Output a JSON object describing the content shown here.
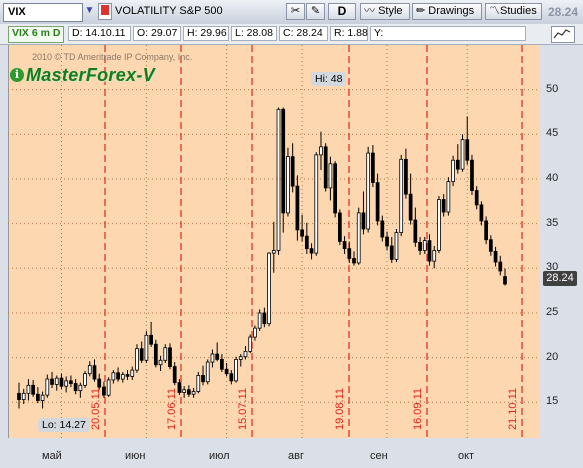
{
  "toolbar": {
    "symbol": "VIX",
    "description": "VOLATILITY S&P 500",
    "aggregation": "D",
    "style_label": "Style",
    "drawings_label": "Drawings",
    "studies_label": "Studies",
    "last_price": "28.24"
  },
  "info_bar": {
    "period": "VIX 6 m D",
    "date": "D: 14.10.11",
    "open": "O: 29.07",
    "high": "H: 29.96",
    "low": "L: 28.08",
    "close": "C: 28.24",
    "range": "R: 1.88",
    "y": "Y:"
  },
  "watermark": {
    "copyright": "2010 © TD Ameritrade IP Company, Inc.",
    "brand": "MasterForex-V"
  },
  "chart_data": {
    "type": "candlestick",
    "symbol": "VIX",
    "ylim": [
      11,
      55
    ],
    "y_ticks": [
      15,
      20,
      25,
      30,
      35,
      40,
      45,
      50
    ],
    "x_month_labels": [
      "май",
      "июн",
      "июл",
      "авг",
      "сен",
      "окт"
    ],
    "vertical_date_markers": [
      "20.05.11",
      "17.06.11",
      "15.07.11",
      "19.08.11",
      "16.09.11",
      "21.10.11"
    ],
    "hi_label": "Hi: 48",
    "lo_label": "Lo: 14.27",
    "last_price_tag": "28.24",
    "candles": [
      {
        "o": 16.0,
        "h": 17.2,
        "l": 14.3,
        "c": 15.3
      },
      {
        "o": 15.3,
        "h": 16.5,
        "l": 14.8,
        "c": 16.0
      },
      {
        "o": 16.0,
        "h": 17.6,
        "l": 15.2,
        "c": 16.9
      },
      {
        "o": 16.9,
        "h": 17.5,
        "l": 15.6,
        "c": 15.9
      },
      {
        "o": 15.9,
        "h": 16.7,
        "l": 14.9,
        "c": 15.2
      },
      {
        "o": 15.2,
        "h": 16.2,
        "l": 14.3,
        "c": 15.8
      },
      {
        "o": 15.8,
        "h": 18.1,
        "l": 15.5,
        "c": 17.6
      },
      {
        "o": 17.6,
        "h": 18.4,
        "l": 16.6,
        "c": 17.0
      },
      {
        "o": 17.0,
        "h": 18.0,
        "l": 16.3,
        "c": 17.7
      },
      {
        "o": 17.7,
        "h": 18.2,
        "l": 16.5,
        "c": 16.8
      },
      {
        "o": 16.8,
        "h": 17.9,
        "l": 16.1,
        "c": 17.4
      },
      {
        "o": 17.4,
        "h": 18.0,
        "l": 16.7,
        "c": 17.1
      },
      {
        "o": 17.1,
        "h": 17.6,
        "l": 15.9,
        "c": 16.3
      },
      {
        "o": 16.3,
        "h": 17.2,
        "l": 15.5,
        "c": 16.9
      },
      {
        "o": 16.9,
        "h": 18.5,
        "l": 16.6,
        "c": 18.2
      },
      {
        "o": 18.2,
        "h": 19.6,
        "l": 17.9,
        "c": 19.1
      },
      {
        "o": 19.1,
        "h": 19.8,
        "l": 17.3,
        "c": 17.6
      },
      {
        "o": 17.6,
        "h": 18.2,
        "l": 16.4,
        "c": 16.7
      },
      {
        "o": 16.7,
        "h": 17.3,
        "l": 15.5,
        "c": 15.8
      },
      {
        "o": 15.8,
        "h": 17.8,
        "l": 15.6,
        "c": 17.5
      },
      {
        "o": 17.5,
        "h": 18.6,
        "l": 17.1,
        "c": 18.3
      },
      {
        "o": 18.3,
        "h": 18.9,
        "l": 17.3,
        "c": 17.6
      },
      {
        "o": 17.6,
        "h": 18.4,
        "l": 17.2,
        "c": 18.1
      },
      {
        "o": 18.1,
        "h": 18.6,
        "l": 17.5,
        "c": 17.9
      },
      {
        "o": 17.9,
        "h": 19.0,
        "l": 17.5,
        "c": 18.6
      },
      {
        "o": 18.6,
        "h": 21.5,
        "l": 18.3,
        "c": 21.0
      },
      {
        "o": 21.0,
        "h": 21.8,
        "l": 19.4,
        "c": 19.7
      },
      {
        "o": 19.7,
        "h": 23.0,
        "l": 19.4,
        "c": 22.5
      },
      {
        "o": 22.5,
        "h": 24.0,
        "l": 21.2,
        "c": 21.5
      },
      {
        "o": 21.5,
        "h": 22.0,
        "l": 18.9,
        "c": 19.2
      },
      {
        "o": 19.2,
        "h": 20.2,
        "l": 18.5,
        "c": 19.7
      },
      {
        "o": 19.7,
        "h": 21.5,
        "l": 19.4,
        "c": 21.1
      },
      {
        "o": 21.1,
        "h": 21.6,
        "l": 18.7,
        "c": 19.0
      },
      {
        "o": 19.0,
        "h": 19.5,
        "l": 16.9,
        "c": 17.2
      },
      {
        "o": 17.2,
        "h": 17.6,
        "l": 15.8,
        "c": 16.1
      },
      {
        "o": 16.1,
        "h": 16.8,
        "l": 15.5,
        "c": 16.4
      },
      {
        "o": 16.4,
        "h": 16.9,
        "l": 15.6,
        "c": 15.9
      },
      {
        "o": 15.9,
        "h": 16.6,
        "l": 15.5,
        "c": 16.2
      },
      {
        "o": 16.2,
        "h": 18.4,
        "l": 16.0,
        "c": 18.0
      },
      {
        "o": 18.0,
        "h": 19.1,
        "l": 16.9,
        "c": 17.3
      },
      {
        "o": 17.3,
        "h": 19.8,
        "l": 17.0,
        "c": 19.5
      },
      {
        "o": 19.5,
        "h": 20.9,
        "l": 18.9,
        "c": 20.4
      },
      {
        "o": 20.4,
        "h": 21.7,
        "l": 19.6,
        "c": 19.8
      },
      {
        "o": 19.8,
        "h": 20.4,
        "l": 18.4,
        "c": 18.7
      },
      {
        "o": 18.7,
        "h": 19.4,
        "l": 17.9,
        "c": 18.2
      },
      {
        "o": 18.2,
        "h": 18.6,
        "l": 17.0,
        "c": 17.4
      },
      {
        "o": 17.4,
        "h": 20.1,
        "l": 17.2,
        "c": 19.8
      },
      {
        "o": 19.8,
        "h": 20.4,
        "l": 19.0,
        "c": 20.1
      },
      {
        "o": 20.1,
        "h": 21.3,
        "l": 19.8,
        "c": 20.7
      },
      {
        "o": 20.7,
        "h": 22.6,
        "l": 20.5,
        "c": 22.3
      },
      {
        "o": 22.3,
        "h": 23.6,
        "l": 21.9,
        "c": 23.3
      },
      {
        "o": 23.3,
        "h": 25.4,
        "l": 23.0,
        "c": 25.0
      },
      {
        "o": 25.0,
        "h": 25.6,
        "l": 23.4,
        "c": 23.8
      },
      {
        "o": 23.8,
        "h": 31.8,
        "l": 23.5,
        "c": 31.7
      },
      {
        "o": 31.7,
        "h": 35.2,
        "l": 29.5,
        "c": 32.0
      },
      {
        "o": 32.0,
        "h": 48.0,
        "l": 31.5,
        "c": 47.8
      },
      {
        "o": 47.8,
        "h": 48.0,
        "l": 34.0,
        "c": 36.2
      },
      {
        "o": 36.2,
        "h": 43.5,
        "l": 35.8,
        "c": 42.5
      },
      {
        "o": 42.5,
        "h": 44.0,
        "l": 38.5,
        "c": 39.2
      },
      {
        "o": 39.2,
        "h": 40.4,
        "l": 33.1,
        "c": 34.3
      },
      {
        "o": 34.3,
        "h": 36.0,
        "l": 33.0,
        "c": 33.6
      },
      {
        "o": 33.6,
        "h": 35.1,
        "l": 31.6,
        "c": 32.2
      },
      {
        "o": 32.2,
        "h": 32.8,
        "l": 31.0,
        "c": 31.7
      },
      {
        "o": 31.7,
        "h": 43.0,
        "l": 31.4,
        "c": 42.7
      },
      {
        "o": 42.7,
        "h": 45.3,
        "l": 41.0,
        "c": 43.6
      },
      {
        "o": 43.6,
        "h": 44.0,
        "l": 38.6,
        "c": 39.0
      },
      {
        "o": 39.0,
        "h": 42.5,
        "l": 37.6,
        "c": 41.7
      },
      {
        "o": 41.7,
        "h": 42.0,
        "l": 35.7,
        "c": 36.2
      },
      {
        "o": 36.2,
        "h": 36.6,
        "l": 32.6,
        "c": 33.0
      },
      {
        "o": 33.0,
        "h": 33.6,
        "l": 31.6,
        "c": 32.2
      },
      {
        "o": 32.2,
        "h": 33.0,
        "l": 30.6,
        "c": 31.1
      },
      {
        "o": 31.1,
        "h": 31.9,
        "l": 30.3,
        "c": 30.6
      },
      {
        "o": 30.6,
        "h": 36.8,
        "l": 30.4,
        "c": 36.2
      },
      {
        "o": 36.2,
        "h": 38.6,
        "l": 33.8,
        "c": 34.4
      },
      {
        "o": 34.4,
        "h": 43.6,
        "l": 34.0,
        "c": 42.9
      },
      {
        "o": 42.9,
        "h": 43.8,
        "l": 39.1,
        "c": 39.6
      },
      {
        "o": 39.6,
        "h": 40.6,
        "l": 34.8,
        "c": 35.3
      },
      {
        "o": 35.3,
        "h": 35.9,
        "l": 33.0,
        "c": 33.5
      },
      {
        "o": 33.5,
        "h": 34.1,
        "l": 32.0,
        "c": 32.5
      },
      {
        "o": 32.5,
        "h": 33.5,
        "l": 30.6,
        "c": 31.0
      },
      {
        "o": 31.0,
        "h": 34.4,
        "l": 30.7,
        "c": 34.0
      },
      {
        "o": 34.0,
        "h": 42.7,
        "l": 33.6,
        "c": 42.2
      },
      {
        "o": 42.2,
        "h": 43.4,
        "l": 37.8,
        "c": 38.3
      },
      {
        "o": 38.3,
        "h": 40.6,
        "l": 34.9,
        "c": 35.4
      },
      {
        "o": 35.4,
        "h": 36.8,
        "l": 32.4,
        "c": 32.9
      },
      {
        "o": 32.9,
        "h": 33.5,
        "l": 31.5,
        "c": 32.0
      },
      {
        "o": 32.0,
        "h": 33.5,
        "l": 31.6,
        "c": 33.1
      },
      {
        "o": 33.1,
        "h": 33.8,
        "l": 30.3,
        "c": 30.8
      },
      {
        "o": 30.8,
        "h": 32.5,
        "l": 30.0,
        "c": 32.0
      },
      {
        "o": 32.0,
        "h": 38.1,
        "l": 31.7,
        "c": 37.7
      },
      {
        "o": 37.7,
        "h": 38.3,
        "l": 35.8,
        "c": 36.3
      },
      {
        "o": 36.3,
        "h": 40.2,
        "l": 35.9,
        "c": 39.7
      },
      {
        "o": 39.7,
        "h": 42.6,
        "l": 39.2,
        "c": 42.1
      },
      {
        "o": 42.1,
        "h": 43.9,
        "l": 40.6,
        "c": 41.1
      },
      {
        "o": 41.1,
        "h": 45.0,
        "l": 40.8,
        "c": 44.4
      },
      {
        "o": 44.4,
        "h": 47.0,
        "l": 41.6,
        "c": 42.1
      },
      {
        "o": 42.1,
        "h": 42.7,
        "l": 38.2,
        "c": 38.7
      },
      {
        "o": 38.7,
        "h": 39.2,
        "l": 36.6,
        "c": 37.1
      },
      {
        "o": 37.1,
        "h": 37.5,
        "l": 34.8,
        "c": 35.3
      },
      {
        "o": 35.3,
        "h": 35.8,
        "l": 32.7,
        "c": 33.2
      },
      {
        "o": 33.2,
        "h": 33.7,
        "l": 31.4,
        "c": 31.9
      },
      {
        "o": 31.9,
        "h": 32.4,
        "l": 30.2,
        "c": 30.7
      },
      {
        "o": 30.7,
        "h": 31.4,
        "l": 29.2,
        "c": 29.7
      },
      {
        "o": 29.07,
        "h": 29.96,
        "l": 28.08,
        "c": 28.24
      }
    ]
  }
}
